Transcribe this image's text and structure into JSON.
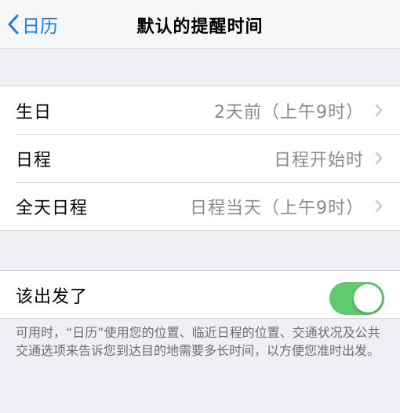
{
  "nav": {
    "back_label": "日历",
    "title": "默认的提醒时间"
  },
  "reminders": {
    "items": [
      {
        "label": "生日",
        "value": "2天前（上午9时）"
      },
      {
        "label": "日程",
        "value": "日程开始时"
      },
      {
        "label": "全天日程",
        "value": "日程当天（上午9时）"
      }
    ]
  },
  "time_to_leave": {
    "label": "该出发了",
    "enabled": true,
    "footnote": "可用时，“日历”使用您的位置、临近日程的位置、交通状况及公共交通选项来告诉您到达目的地需要多长时间，以方便您准时出发。"
  },
  "colors": {
    "accent": "#1a7cf5",
    "toggle_on": "#5fcb6d",
    "background": "#efeff4",
    "secondary_text": "#8a8a8e"
  }
}
